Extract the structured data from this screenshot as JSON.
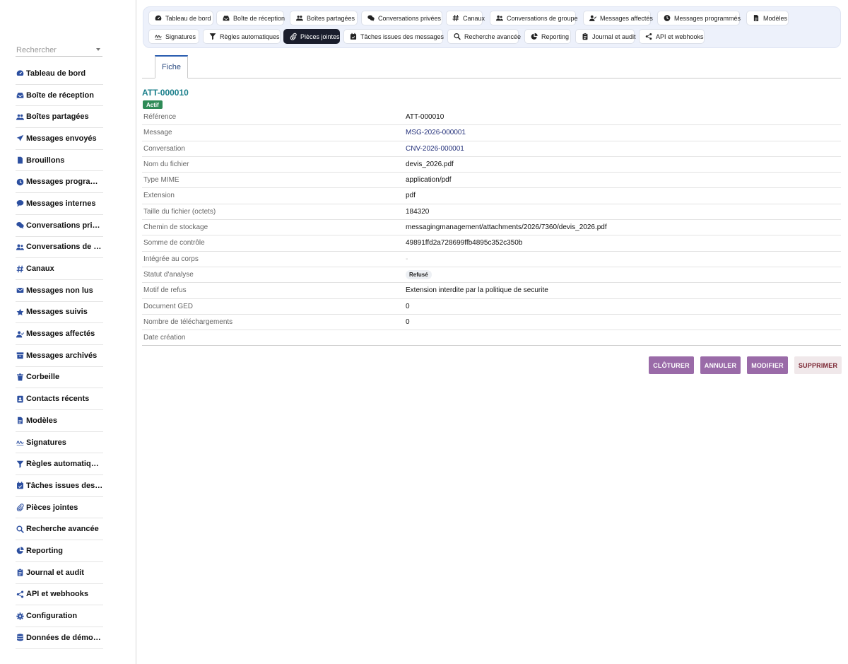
{
  "sidebar": {
    "search_placeholder": "Rechercher",
    "items": [
      {
        "label": "Tableau de bord",
        "icon": "gauge-icon"
      },
      {
        "label": "Boîte de réception",
        "icon": "inbox-icon"
      },
      {
        "label": "Boîtes partagées",
        "icon": "users-icon"
      },
      {
        "label": "Messages envoyés",
        "icon": "paper-plane-icon"
      },
      {
        "label": "Brouillons",
        "icon": "file-icon"
      },
      {
        "label": "Messages programmés",
        "icon": "clock-icon"
      },
      {
        "label": "Messages internes",
        "icon": "comment-icon"
      },
      {
        "label": "Conversations privées",
        "icon": "comments-icon"
      },
      {
        "label": "Conversations de groupe",
        "icon": "user-group-icon"
      },
      {
        "label": "Canaux",
        "icon": "hashtag-icon"
      },
      {
        "label": "Messages non lus",
        "icon": "envelope-icon"
      },
      {
        "label": "Messages suivis",
        "icon": "star-icon"
      },
      {
        "label": "Messages affectés",
        "icon": "user-check-icon"
      },
      {
        "label": "Messages archivés",
        "icon": "archive-icon"
      },
      {
        "label": "Corbeille",
        "icon": "trash-icon"
      },
      {
        "label": "Contacts récents",
        "icon": "contact-card-icon"
      },
      {
        "label": "Modèles",
        "icon": "file-text-icon"
      },
      {
        "label": "Signatures",
        "icon": "signature-icon"
      },
      {
        "label": "Règles automatiques",
        "icon": "filter-icon"
      },
      {
        "label": "Tâches issues des messages",
        "icon": "calendar-check-icon"
      },
      {
        "label": "Pièces jointes",
        "icon": "paperclip-icon"
      },
      {
        "label": "Recherche avancée",
        "icon": "magnifier-icon"
      },
      {
        "label": "Reporting",
        "icon": "pie-chart-icon"
      },
      {
        "label": "Journal et audit",
        "icon": "clipboard-icon"
      },
      {
        "label": "API et webhooks",
        "icon": "share-nodes-icon"
      },
      {
        "label": "Configuration",
        "icon": "gear-icon"
      },
      {
        "label": "Données de démonstration",
        "icon": "database-icon"
      }
    ]
  },
  "tabbar": {
    "row1": [
      {
        "label": "Tableau de bord",
        "icon": "gauge-icon"
      },
      {
        "label": "Boîte de réception",
        "icon": "inbox-icon"
      },
      {
        "label": "Boîtes partagées",
        "icon": "users-icon"
      },
      {
        "label": "Conversations privées",
        "icon": "comments-icon"
      },
      {
        "label": "Canaux",
        "icon": "hashtag-icon"
      },
      {
        "label": "Conversations de groupe",
        "icon": "user-group-icon"
      },
      {
        "label": "Messages affectés",
        "icon": "user-check-icon"
      },
      {
        "label": "Messages programmés",
        "icon": "clock-icon"
      },
      {
        "label": "Modèles",
        "icon": "file-text-icon"
      }
    ],
    "row2": [
      {
        "label": "Signatures",
        "icon": "signature-icon"
      },
      {
        "label": "Règles automatiques",
        "icon": "filter-icon"
      },
      {
        "label": "Pièces jointes",
        "icon": "paperclip-icon",
        "active": true
      },
      {
        "label": "Tâches issues des messages",
        "icon": "calendar-check-icon"
      },
      {
        "label": "Recherche avancée",
        "icon": "magnifier-icon"
      },
      {
        "label": "Reporting",
        "icon": "pie-chart-icon"
      },
      {
        "label": "Journal et audit",
        "icon": "clipboard-icon"
      },
      {
        "label": "API et webhooks",
        "icon": "share-nodes-icon"
      }
    ]
  },
  "record": {
    "tab_label": "Fiche",
    "title": "ATT-000010",
    "status_badge": "Actif",
    "fields": [
      {
        "label": "Référence",
        "value": "ATT-000010",
        "kind": "text"
      },
      {
        "label": "Message",
        "value": "MSG-2026-000001",
        "kind": "link"
      },
      {
        "label": "Conversation",
        "value": "CNV-2026-000001",
        "kind": "link"
      },
      {
        "label": "Nom du fichier",
        "value": "devis_2026.pdf",
        "kind": "text"
      },
      {
        "label": "Type MIME",
        "value": "application/pdf",
        "kind": "text"
      },
      {
        "label": "Extension",
        "value": "pdf",
        "kind": "text"
      },
      {
        "label": "Taille du fichier (octets)",
        "value": "184320",
        "kind": "text"
      },
      {
        "label": "Chemin de stockage",
        "value": "messagingmanagement/attachments/2026/7360/devis_2026.pdf",
        "kind": "text"
      },
      {
        "label": "Somme de contrôle",
        "value": "49891ffd2a728699ffb4895c352c350b",
        "kind": "text"
      },
      {
        "label": "Intégrée au corps",
        "value": "-",
        "kind": "muted"
      },
      {
        "label": "Statut d'analyse",
        "value": "Refusé",
        "kind": "pill"
      },
      {
        "label": "Motif de refus",
        "value": "Extension interdite par la politique de securite",
        "kind": "text"
      },
      {
        "label": "Document GED",
        "value": "0",
        "kind": "text"
      },
      {
        "label": "Nombre de téléchargements",
        "value": "0",
        "kind": "text"
      },
      {
        "label": "Date création",
        "value": "",
        "kind": "text"
      }
    ]
  },
  "actions": {
    "close_label": "CLÔTURER",
    "cancel_label": "ANNULER",
    "edit_label": "MODIFIER",
    "delete_label": "SUPPRIMER"
  },
  "colors": {
    "accent": "#9a6ba8",
    "active_tab": "#1a1d2c",
    "title": "#1b7f8b",
    "badge": "#2e8b57",
    "link": "#23307a",
    "danger_text": "#7a2531"
  }
}
